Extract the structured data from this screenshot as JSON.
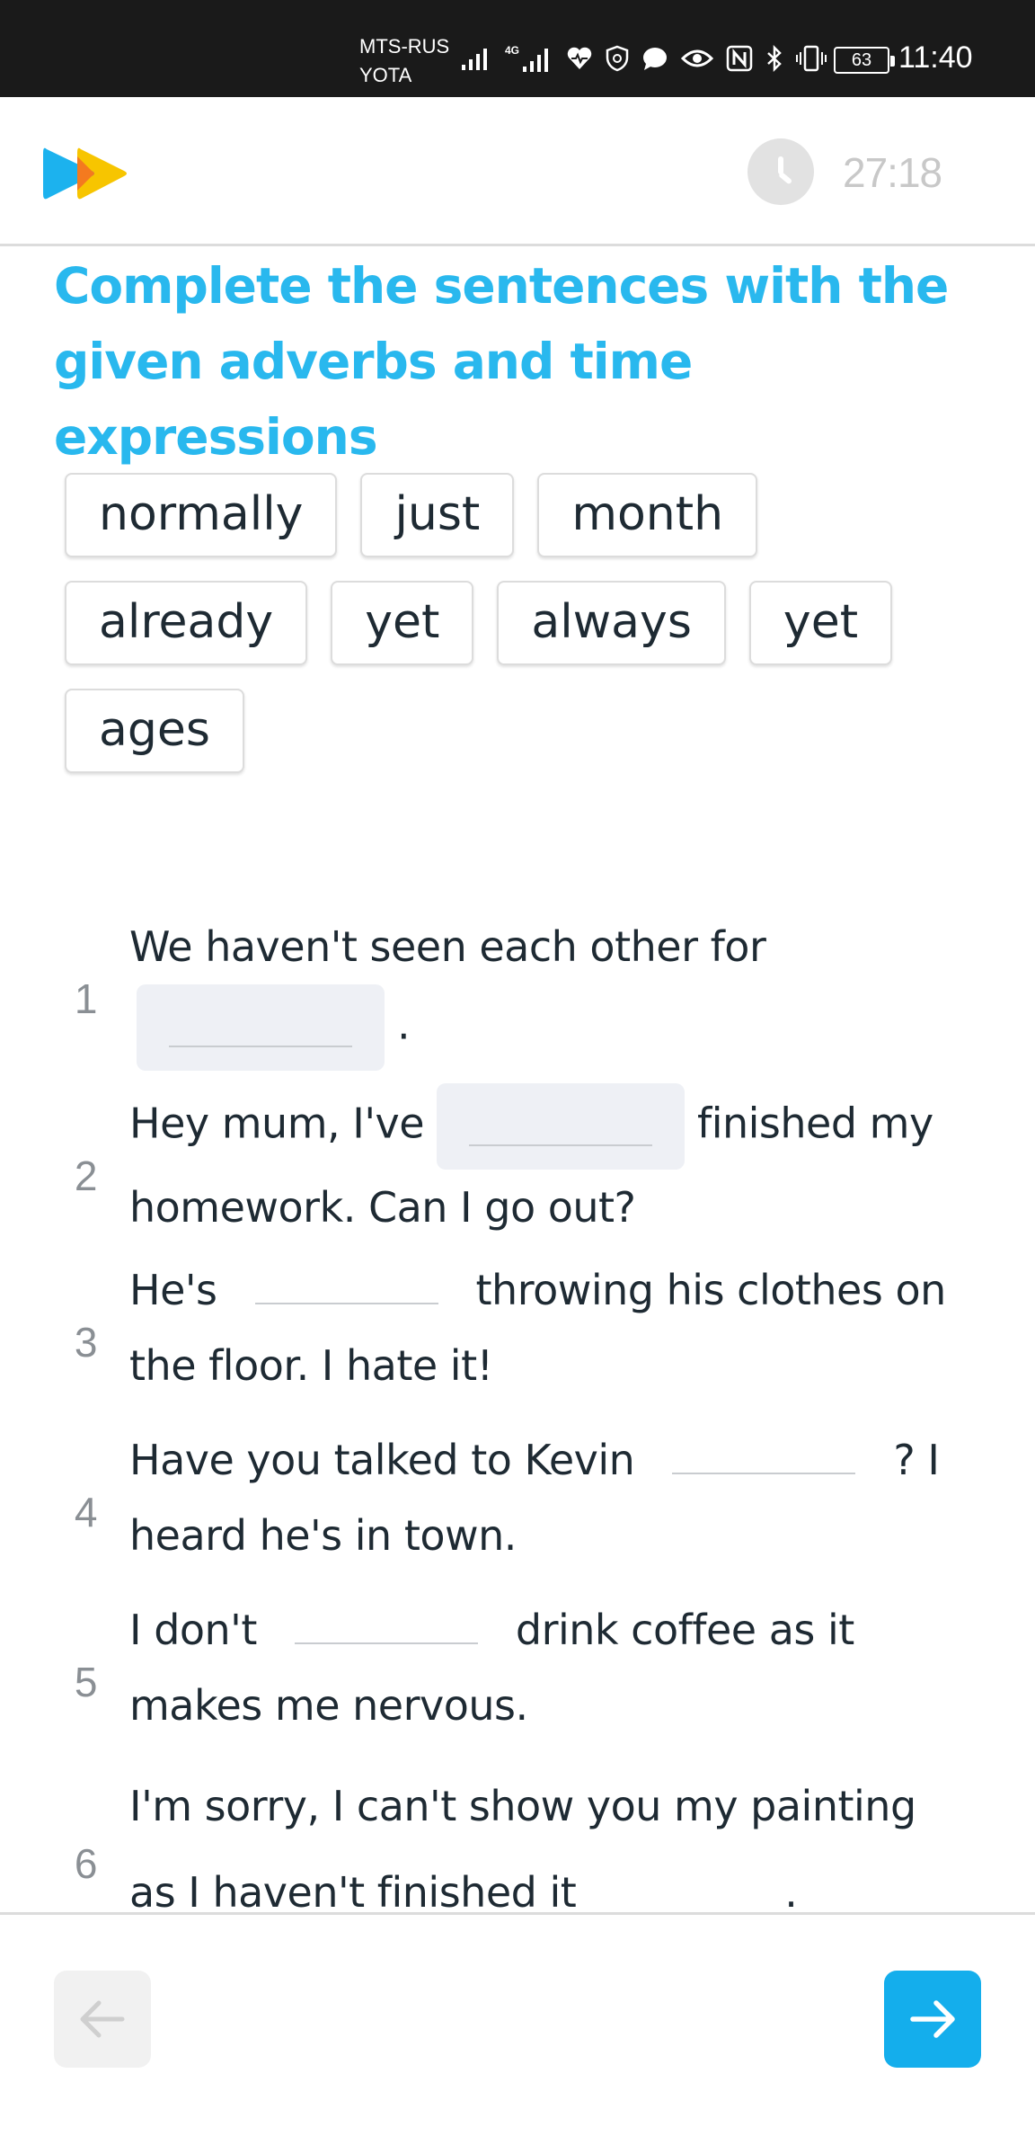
{
  "status_bar": {
    "carrier_1": "MTS-RUS",
    "carrier_2": "YOTA",
    "network": "4G",
    "battery": "63",
    "time": "11:40"
  },
  "header": {
    "timer": "27:18",
    "icons": [
      "play-logo-icon",
      "clock-icon"
    ],
    "brand_colors": {
      "blue": "#1cb2ee",
      "yellow": "#f7c500",
      "orange": "#f47a1f"
    }
  },
  "exercise": {
    "title": "Complete the sentences with the given adverbs and time expressions",
    "word_bank": [
      "normally",
      "just",
      "month",
      "already",
      "yet",
      "always",
      "yet",
      "ages"
    ],
    "sentences": [
      {
        "number": "1",
        "before": "We haven't seen each other for",
        "after": "."
      },
      {
        "number": "2",
        "before": "Hey mum, I've",
        "after": "finished my homework. Can I go out?"
      },
      {
        "number": "3",
        "before": "He's",
        "after": "throwing his clothes on the floor. I hate it!"
      },
      {
        "number": "4",
        "before": "Have you talked to Kevin",
        "after": "? I heard he's in town."
      },
      {
        "number": "5",
        "before": "I don't",
        "after": "drink coffee as it makes me nervous."
      },
      {
        "number": "6",
        "before": "I'm sorry, I can't show you my painting as I haven't finished it",
        "after": "."
      }
    ]
  },
  "navigation": {
    "prev_icon": "arrow-left-icon",
    "next_icon": "arrow-right-icon",
    "accent": "#14aeec"
  }
}
